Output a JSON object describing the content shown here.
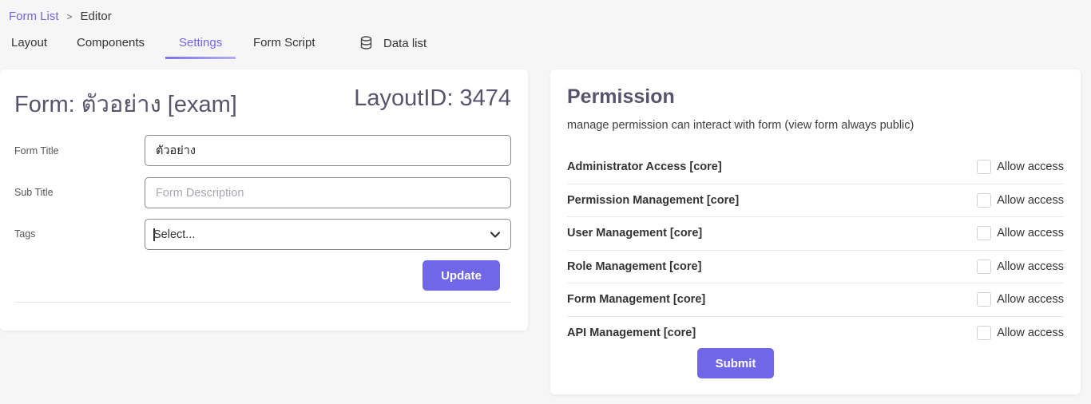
{
  "breadcrumb": {
    "parent": "Form List",
    "separator": ">",
    "current": "Editor"
  },
  "tabs": [
    {
      "label": "Layout",
      "active": false
    },
    {
      "label": "Components",
      "active": false
    },
    {
      "label": "Settings",
      "active": true
    },
    {
      "label": "Form Script",
      "active": false
    },
    {
      "label": "Data list",
      "active": false,
      "icon": "database-icon"
    }
  ],
  "settings": {
    "heading": "Form: ตัวอย่าง [exam]",
    "layout_id": "LayoutID: 3474",
    "fields": {
      "form_title": {
        "label": "Form Title",
        "value": "ตัวอย่าง"
      },
      "sub_title": {
        "label": "Sub Title",
        "value": "",
        "placeholder": "Form Description"
      },
      "tags": {
        "label": "Tags",
        "placeholder": "Select..."
      }
    },
    "update_label": "Update"
  },
  "permission": {
    "title": "Permission",
    "description": "manage permission can interact with form (view form always public)",
    "items": [
      {
        "name": "Administrator Access [core]",
        "check_label": "Allow access",
        "checked": false
      },
      {
        "name": "Permission Management [core]",
        "check_label": "Allow access",
        "checked": false
      },
      {
        "name": "User Management [core]",
        "check_label": "Allow access",
        "checked": false
      },
      {
        "name": "Role Management [core]",
        "check_label": "Allow access",
        "checked": false
      },
      {
        "name": "Form Management [core]",
        "check_label": "Allow access",
        "checked": false
      },
      {
        "name": "API Management [core]",
        "check_label": "Allow access",
        "checked": false
      }
    ],
    "submit_label": "Submit"
  },
  "colors": {
    "accent": "#6f66e8",
    "heading": "#57546b",
    "background": "#f6f6f6"
  }
}
